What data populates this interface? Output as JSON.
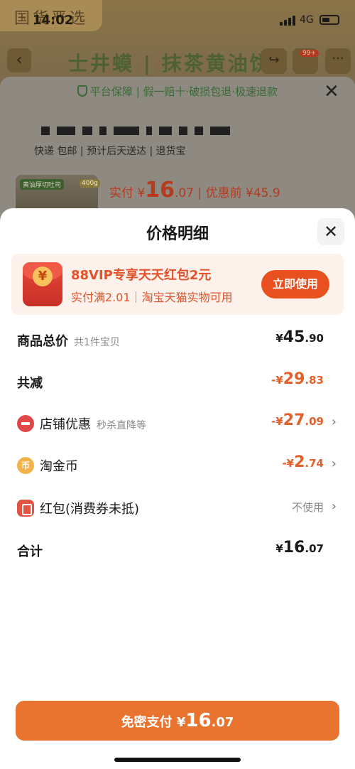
{
  "status_bar": {
    "time": "14:02",
    "network": "4G",
    "overlay_brand": "国货严选"
  },
  "background": {
    "nav_title": "士井蟆 | 抹茶黄油饼",
    "cart_badge": "99+",
    "guarantee": "平台保障 | 假一赔十·破损包退·极速退款",
    "tags": "快递 包邮 | 预计后天送达 | 退货宝",
    "thumb_label": "黄油厚切吐司",
    "thumb_weight": "400g",
    "price_prefix": "实付 ¥",
    "price_int": "16",
    "price_dec": ".07",
    "price_before": " | 优惠前 ¥45.9"
  },
  "sheet": {
    "title": "价格明细",
    "promo": {
      "yen": "¥",
      "title": "88VIP专享天天红包2元",
      "subtitle": "实付满2.01｜淘宝天猫实物可用",
      "button": "立即使用"
    },
    "rows": {
      "total": {
        "label": "商品总价",
        "note": "共1件宝贝",
        "prefix": "¥",
        "int": "45",
        "dec": ".90"
      },
      "reduce": {
        "label": "共减",
        "prefix": "-¥",
        "int": "29",
        "dec": ".83"
      },
      "shop": {
        "label": "店铺优惠",
        "note": "秒杀直降等",
        "prefix": "-¥",
        "int": "27",
        "dec": ".09"
      },
      "coin": {
        "label": "淘金币",
        "icon_glyph": "币",
        "prefix": "-¥",
        "int": "2",
        "dec": ".74"
      },
      "redpack": {
        "label": "红包(消费券未抵)",
        "value": "不使用"
      },
      "sum": {
        "label": "合计",
        "prefix": "¥",
        "int": "16",
        "dec": ".07"
      }
    },
    "pay": {
      "label": "免密支付 ¥",
      "int": "16",
      "dec": ".07"
    }
  },
  "colors": {
    "accent": "#e8501f",
    "pay_button": "#e8742f",
    "discount_text": "#e2602a"
  },
  "icons": [
    "back-icon",
    "share-icon",
    "cart-icon",
    "more-icon",
    "shield-icon",
    "close-icon",
    "chevron-right-icon",
    "red-packet-icon",
    "coin-icon",
    "shop-discount-icon"
  ]
}
